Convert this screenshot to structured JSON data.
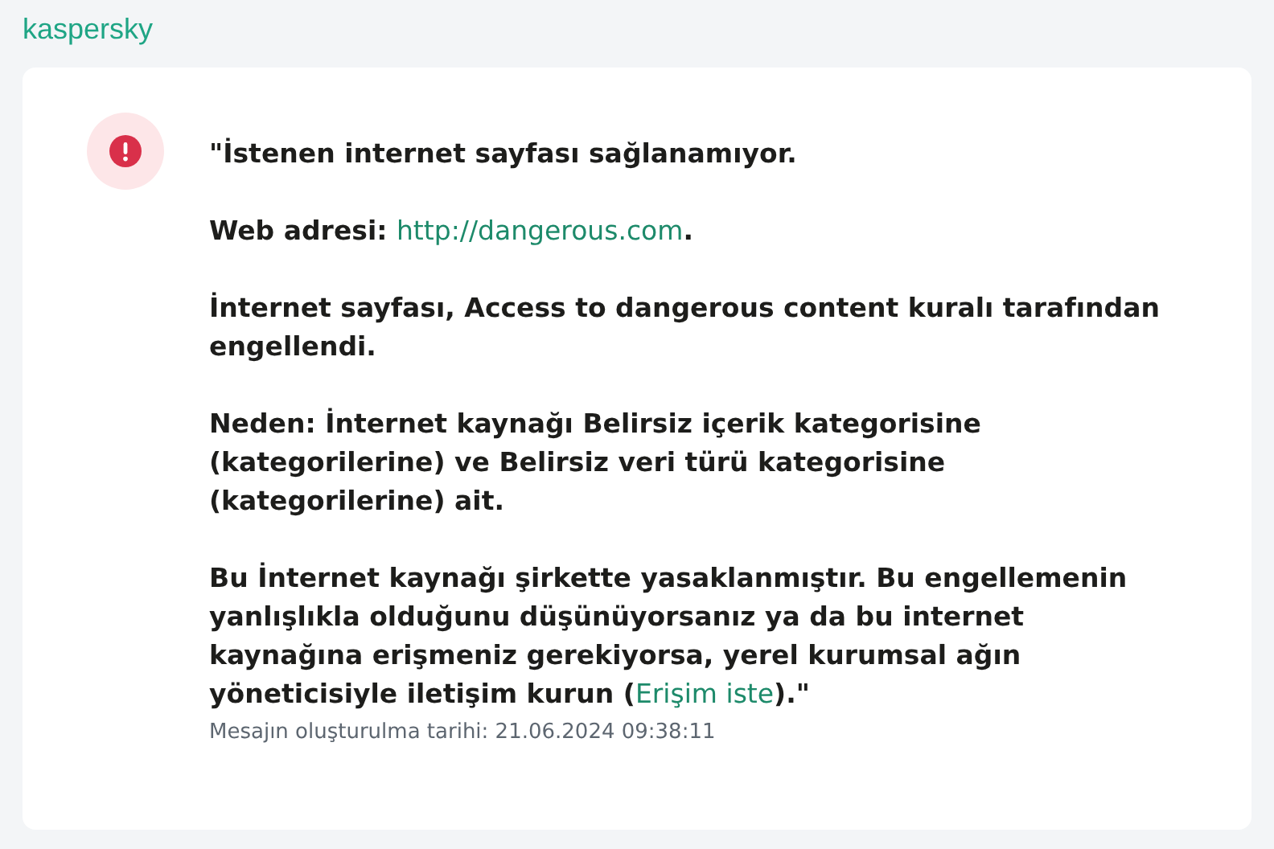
{
  "logo": "kaspersky",
  "paragraphs": [
    {
      "text": "\"İstenen internet sayfası sağlanamıyor."
    },
    {
      "text": "Web adresi: ",
      "link": "http://dangerous.com",
      "after": "."
    },
    {
      "text": "İnternet sayfası, Access to dangerous content kuralı tarafından engellendi."
    },
    {
      "text": "Neden: İnternet kaynağı Belirsiz içerik kategorisine (kategorilerine) ve Belirsiz veri türü kategorisine (kategorilerine) ait."
    },
    {
      "text": "Bu İnternet kaynağı şirkette yasaklanmıştır. Bu engellemenin yanlışlıkla olduğunu düşünüyorsanız ya da bu internet kaynağına erişmeniz gerekiyorsa, yerel kurumsal ağın yöneticisiyle iletişim kurun (",
      "link": "Erişim iste",
      "after": ").\""
    }
  ],
  "timestamp": "Mesajın oluşturulma tarihi: 21.06.2024 09:38:11"
}
